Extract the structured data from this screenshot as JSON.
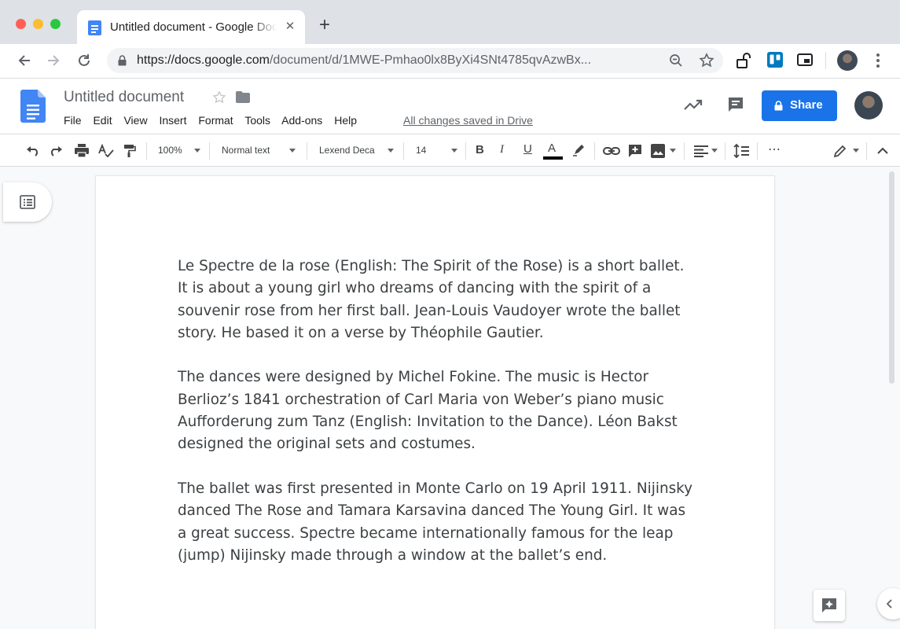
{
  "browser": {
    "tab_title": "Untitled document - Google Docs",
    "url_host": "https://docs.google.com",
    "url_path": "/document/d/1MWE-Pmhao0lx8ByXi4SNt4785qvAzwBx..."
  },
  "docs": {
    "title": "Untitled document",
    "menu": [
      "File",
      "Edit",
      "View",
      "Insert",
      "Format",
      "Tools",
      "Add-ons",
      "Help"
    ],
    "save_status": "All changes saved in Drive",
    "share_label": "Share"
  },
  "format_toolbar": {
    "zoom": "100%",
    "style": "Normal text",
    "font": "Lexend Deca",
    "size": "14",
    "bold": "B",
    "italic": "I",
    "underline": "U",
    "text_color": "A",
    "more": "⋯"
  },
  "document": {
    "paragraphs": [
      "Le Spectre de la rose (English: The Spirit of the Rose) is a short ballet. It is about a young girl who dreams of dancing with the spirit of a souvenir rose from her first ball. Jean-Louis Vaudoyer wrote the ballet story. He based it on a verse by Théophile Gautier.",
      "The dances were designed by Michel Fokine. The music is Hector Berlioz’s 1841 orchestration of Carl Maria von Weber’s piano music Aufforderung zum Tanz (English: Invitation to the Dance). Léon Bakst designed the original sets and costumes.",
      "The ballet was first presented in Monte Carlo on 19 April 1911. Nijinsky danced The Rose and Tamara Karsavina danced The Young Girl. It was a great success. Spectre became internationally famous for the leap (jump) Nijinsky made through a window at the ballet’s end."
    ]
  },
  "colors": {
    "accent": "#1a73e8",
    "docs_blue": "#4285f4",
    "text": "#3c4043"
  }
}
